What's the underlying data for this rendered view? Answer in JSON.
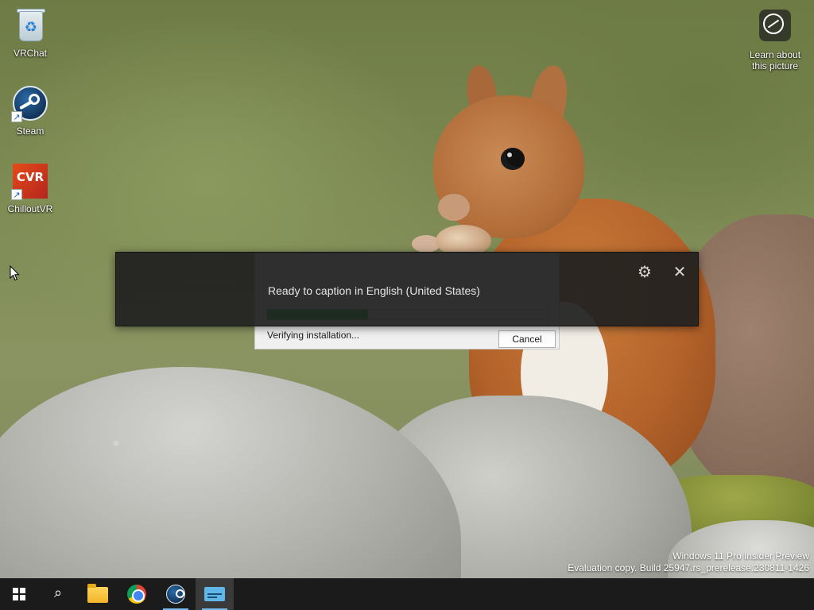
{
  "desktop": {
    "icons": [
      {
        "label": "VRChat",
        "icon": "recycle-bin-icon"
      },
      {
        "label": "Steam",
        "icon": "steam-icon"
      },
      {
        "label": "ChilloutVR",
        "icon": "chilloutvr-icon"
      },
      {
        "label": "Learn about this picture",
        "icon": "spotlight-info-icon"
      }
    ],
    "wallpaper": "red-squirrel-on-rock-wallpaper"
  },
  "captions": {
    "status_text": "Ready to caption in English (United States)",
    "settings_icon": "gear-icon",
    "close_icon": "close-icon",
    "glyph_gear": "⚙",
    "glyph_close": "✕"
  },
  "installer": {
    "status_text": "Verifying installation...",
    "cancel_label": "Cancel",
    "progress": 0.36,
    "progress_color": "#06b025"
  },
  "watermark": {
    "line1": "Windows 11 Pro Insider Preview",
    "line2": "Evaluation copy. Build 25947.rs_prerelease.230811-1426"
  },
  "taskbar": {
    "items": [
      {
        "name": "Start",
        "icon": "windows-logo-icon"
      },
      {
        "name": "Search",
        "icon": "search-icon",
        "glyph": "⌕"
      },
      {
        "name": "File Explorer",
        "icon": "folder-icon"
      },
      {
        "name": "Google Chrome",
        "icon": "chrome-icon"
      },
      {
        "name": "Steam",
        "icon": "steam-icon"
      },
      {
        "name": "Live captions",
        "icon": "live-captions-icon"
      }
    ],
    "background": "#1b1b1b",
    "indicator_color": "#76b9ed"
  }
}
